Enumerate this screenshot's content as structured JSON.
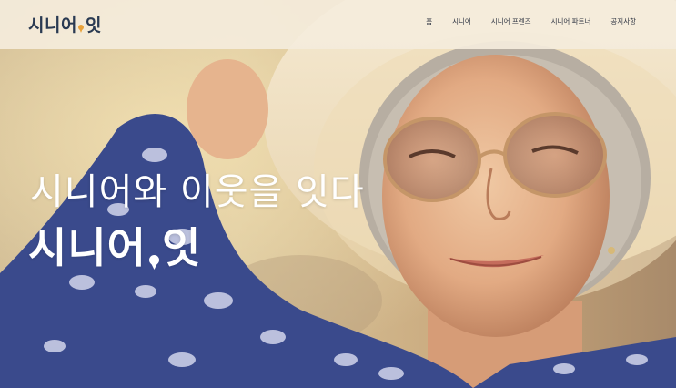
{
  "header": {
    "logo": {
      "part1": "시니어",
      "part2": "잇",
      "dot_color": "#e9a23a"
    },
    "nav": [
      {
        "label": "홈",
        "active": true
      },
      {
        "label": "시니어",
        "active": false
      },
      {
        "label": "시니어 프렌즈",
        "active": false
      },
      {
        "label": "시니어 파트너",
        "active": false
      },
      {
        "label": "공지사항",
        "active": false
      }
    ]
  },
  "hero": {
    "tagline": "시니어와 이웃을 잇다",
    "brand": {
      "part1": "시니어",
      "part2": "잇",
      "dot_color": "#ffffff"
    },
    "image": "smiling-senior-woman-in-sunhat-photo"
  }
}
